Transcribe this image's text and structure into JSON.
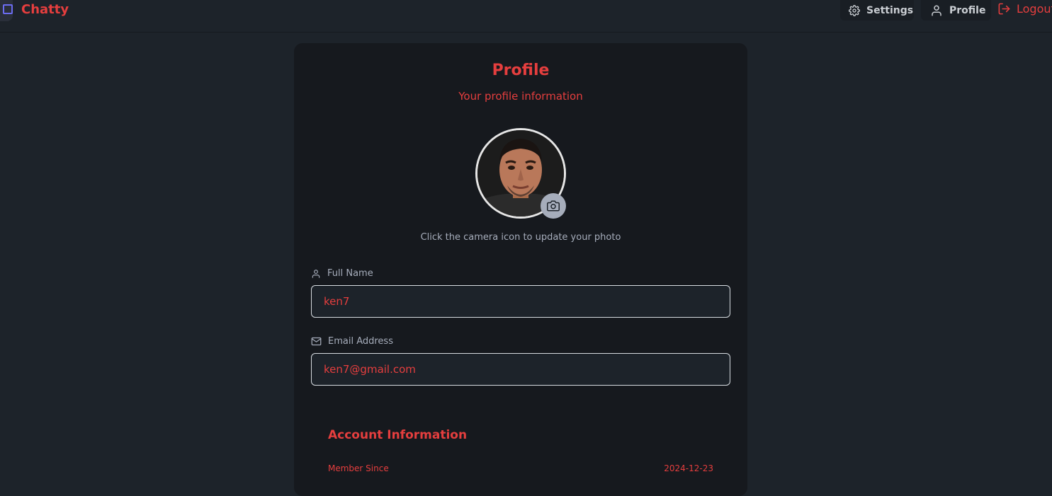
{
  "app": {
    "brand": "Chatty"
  },
  "nav": {
    "settings_label": "Settings",
    "profile_label": "Profile",
    "logout_label": "Logout"
  },
  "profile": {
    "title": "Profile",
    "subtitle": "Your profile information",
    "photo_hint": "Click the camera icon to update your photo",
    "full_name_label": "Full Name",
    "full_name_value": "ken7",
    "email_label": "Email Address",
    "email_value": "ken7@gmail.com"
  },
  "account": {
    "title": "Account Information",
    "member_since_label": "Member Since",
    "member_since_value": "2024-12-23"
  },
  "colors": {
    "accent": "#e53e3e",
    "background": "#1d232a",
    "card": "#16191e"
  },
  "icons": {
    "logo": "message-square-icon",
    "settings": "gear-icon",
    "profile": "user-icon",
    "logout": "logout-icon",
    "camera": "camera-icon",
    "name": "user-icon",
    "email": "mail-icon"
  }
}
